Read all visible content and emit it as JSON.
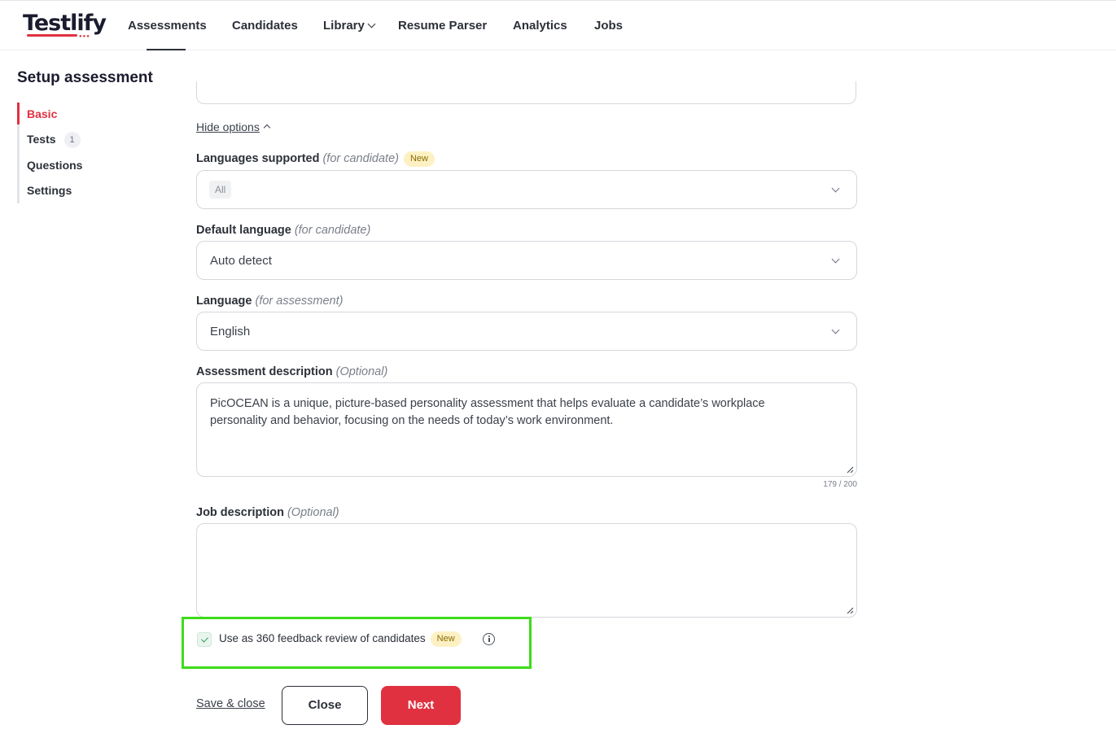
{
  "app": {
    "logo_text": "Testlify",
    "nav": {
      "assessments": "Assessments",
      "candidates": "Candidates",
      "library": "Library",
      "resume_parser": "Resume Parser",
      "analytics": "Analytics",
      "jobs": "Jobs",
      "active": "Assessments"
    }
  },
  "sidebar": {
    "title": "Setup assessment",
    "items": [
      {
        "label": "Basic",
        "active": true
      },
      {
        "label": "Tests",
        "count": "1"
      },
      {
        "label": "Questions"
      },
      {
        "label": "Settings"
      }
    ]
  },
  "form": {
    "hide_options": "Hide options",
    "languages_supported": {
      "label": "Languages supported",
      "hint": "(for candidate)",
      "badge": "New",
      "chip": "All"
    },
    "default_language": {
      "label": "Default language",
      "hint": "(for candidate)",
      "value": "Auto detect"
    },
    "language": {
      "label": "Language",
      "hint": "(for assessment)",
      "value": "English"
    },
    "assessment_description": {
      "label": "Assessment description",
      "hint": "(Optional)",
      "value": "PicOCEAN is a unique, picture-based personality assessment that helps evaluate a candidate’s workplace personality and behavior, focusing on the needs of today’s work environment.",
      "char_count": "179 / 200"
    },
    "job_description": {
      "label": "Job description",
      "hint": "(Optional)",
      "value": ""
    },
    "feedback_360": {
      "label": "Use as 360 feedback review of candidates",
      "badge": "New",
      "checked": true
    }
  },
  "footer": {
    "save_close": "Save & close",
    "close": "Close",
    "next": "Next"
  },
  "colors": {
    "accent": "#e03141",
    "highlight": "#3ddc18",
    "badge_bg": "#fdf1c4"
  }
}
